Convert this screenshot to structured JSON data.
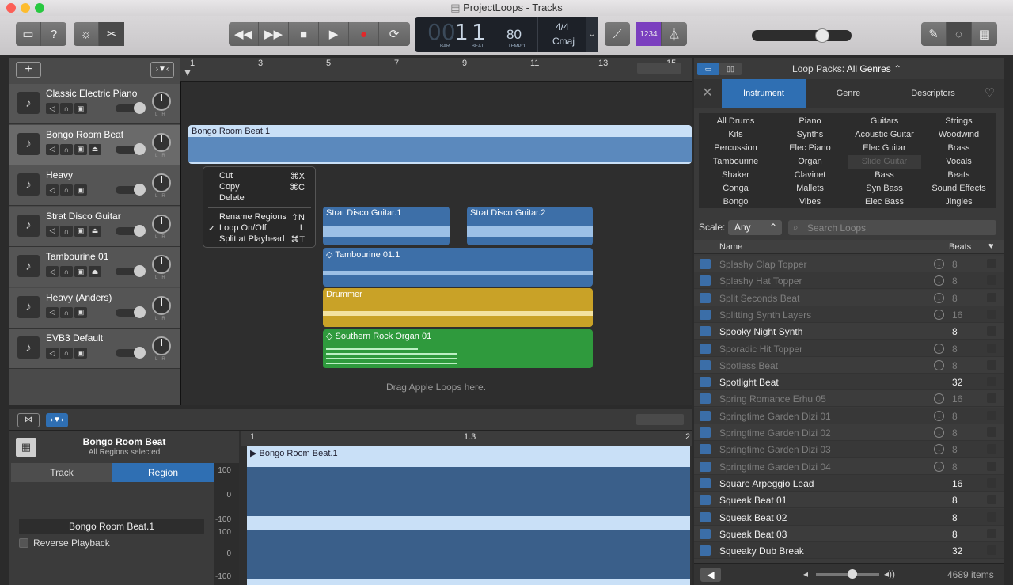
{
  "window": {
    "title": "ProjectLoops - Tracks"
  },
  "lcd": {
    "bar": "1",
    "beat": "1",
    "bar_prefix": "00",
    "bar_label": "BAR",
    "beat_label": "BEAT",
    "tempo": "80",
    "tempo_label": "TEMPO",
    "signature": "4/4",
    "key": "Cmaj"
  },
  "toolbar": {
    "count_in": "1234"
  },
  "tracks": [
    {
      "name": "Classic Electric Piano",
      "icon": "piano-icon"
    },
    {
      "name": "Bongo Room Beat",
      "icon": "drum-machine-icon"
    },
    {
      "name": "Heavy",
      "icon": "drum-kit-icon"
    },
    {
      "name": "Strat Disco Guitar",
      "icon": "guitar-icon"
    },
    {
      "name": "Tambourine 01",
      "icon": "tambourine-icon"
    },
    {
      "name": "Heavy (Anders)",
      "icon": "drum-kit-icon"
    },
    {
      "name": "EVB3 Default",
      "icon": "organ-icon"
    }
  ],
  "ruler": [
    "1",
    "3",
    "5",
    "7",
    "9",
    "11",
    "13",
    "15"
  ],
  "regions": {
    "bongo": "Bongo Room Beat.1",
    "strat1": "Strat Disco Guitar.1",
    "strat2": "Strat Disco Guitar.2",
    "tamb": "Tambourine 01.1",
    "drummer": "Drummer",
    "organ": "Southern Rock Organ 01"
  },
  "drop_hint": "Drag Apple Loops here.",
  "context_menu": {
    "items": [
      {
        "label": "Cut",
        "shortcut": "⌘X"
      },
      {
        "label": "Copy",
        "shortcut": "⌘C"
      },
      {
        "label": "Delete",
        "shortcut": ""
      },
      {
        "label": "Rename Regions",
        "shortcut": "⇧N"
      },
      {
        "label": "Loop On/Off",
        "shortcut": "L",
        "checked": true
      },
      {
        "label": "Split at Playhead",
        "shortcut": "⌘T"
      }
    ]
  },
  "editor": {
    "track_name": "Bongo Room Beat",
    "subtitle": "All Regions selected",
    "tab_track": "Track",
    "tab_region": "Region",
    "region_name": "Bongo Room Beat.1",
    "reverse_label": "Reverse Playback",
    "region_title": "Bongo Room Beat.1",
    "ruler": [
      "1",
      "1.3",
      "2"
    ],
    "scale": [
      "100",
      "0",
      "-100",
      "100",
      "0",
      "-100"
    ]
  },
  "browser": {
    "loop_packs_label": "Loop Packs:",
    "loop_packs_value": "All Genres",
    "tabs": [
      "Instrument",
      "Genre",
      "Descriptors"
    ],
    "categories": [
      [
        "All Drums",
        "Piano",
        "Guitars",
        "Strings"
      ],
      [
        "Kits",
        "Synths",
        "Acoustic Guitar",
        "Woodwind"
      ],
      [
        "Percussion",
        "Elec Piano",
        "Elec Guitar",
        "Brass"
      ],
      [
        "Tambourine",
        "Organ",
        "Slide Guitar",
        "Vocals"
      ],
      [
        "Shaker",
        "Clavinet",
        "Bass",
        "Beats"
      ],
      [
        "Conga",
        "Mallets",
        "Syn Bass",
        "Sound Effects"
      ],
      [
        "Bongo",
        "Vibes",
        "Elec Bass",
        "Jingles"
      ]
    ],
    "scale_label": "Scale:",
    "scale_value": "Any",
    "search_placeholder": "Search Loops",
    "col_name": "Name",
    "col_beats": "Beats",
    "loops": [
      {
        "name": "Splashy Clap Topper",
        "beats": "8",
        "dl": true
      },
      {
        "name": "Splashy Hat Topper",
        "beats": "8",
        "dl": true
      },
      {
        "name": "Split Seconds Beat",
        "beats": "8",
        "dl": true
      },
      {
        "name": "Splitting Synth Layers",
        "beats": "16",
        "dl": true
      },
      {
        "name": "Spooky Night Synth",
        "beats": "8",
        "dl": false
      },
      {
        "name": "Sporadic Hit Topper",
        "beats": "8",
        "dl": true
      },
      {
        "name": "Spotless Beat",
        "beats": "8",
        "dl": true
      },
      {
        "name": "Spotlight Beat",
        "beats": "32",
        "dl": false
      },
      {
        "name": "Spring Romance Erhu 05",
        "beats": "16",
        "dl": true
      },
      {
        "name": "Springtime Garden Dizi 01",
        "beats": "8",
        "dl": true
      },
      {
        "name": "Springtime Garden Dizi 02",
        "beats": "8",
        "dl": true
      },
      {
        "name": "Springtime Garden Dizi 03",
        "beats": "8",
        "dl": true
      },
      {
        "name": "Springtime Garden Dizi 04",
        "beats": "8",
        "dl": true
      },
      {
        "name": "Square Arpeggio Lead",
        "beats": "16",
        "dl": false
      },
      {
        "name": "Squeak Beat 01",
        "beats": "8",
        "dl": false
      },
      {
        "name": "Squeak Beat 02",
        "beats": "8",
        "dl": false
      },
      {
        "name": "Squeak Beat 03",
        "beats": "8",
        "dl": false
      },
      {
        "name": "Squeaky Dub Break",
        "beats": "32",
        "dl": false
      }
    ],
    "item_count": "4689 items"
  }
}
